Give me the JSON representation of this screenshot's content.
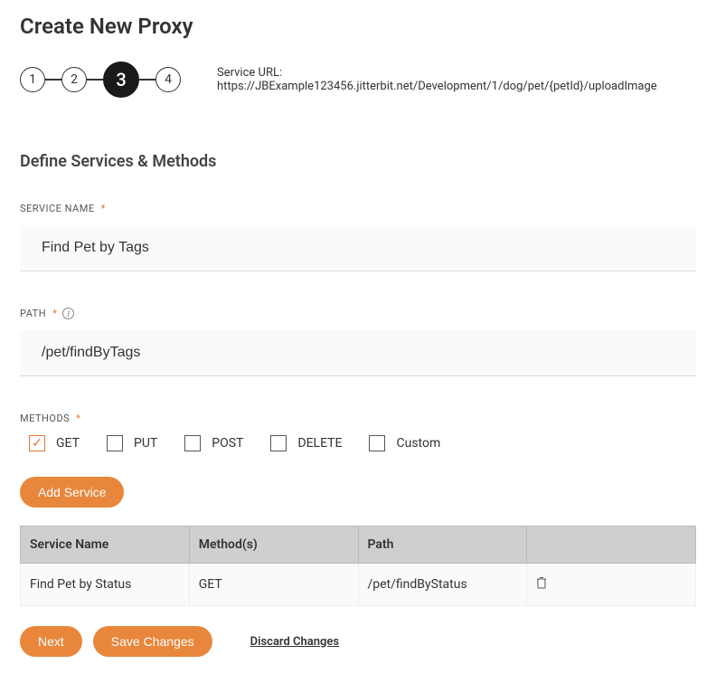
{
  "page": {
    "title": "Create New Proxy",
    "service_url_label": "Service URL:",
    "service_url": "https://JBExample123456.jitterbit.net/Development/1/dog/pet/{petId}/uploadImage"
  },
  "stepper": {
    "steps": [
      "1",
      "2",
      "3",
      "4"
    ],
    "active": "3"
  },
  "section": {
    "title": "Define Services & Methods"
  },
  "fields": {
    "service_name": {
      "label": "SERVICE NAME",
      "value": "Find Pet by Tags"
    },
    "path": {
      "label": "PATH",
      "value": "/pet/findByTags"
    },
    "methods": {
      "label": "METHODS",
      "options": [
        {
          "label": "GET",
          "checked": true
        },
        {
          "label": "PUT",
          "checked": false
        },
        {
          "label": "POST",
          "checked": false
        },
        {
          "label": "DELETE",
          "checked": false
        },
        {
          "label": "Custom",
          "checked": false
        }
      ]
    }
  },
  "buttons": {
    "add_service": "Add Service",
    "next": "Next",
    "save_changes": "Save Changes",
    "discard_changes": "Discard Changes"
  },
  "table": {
    "headers": [
      "Service Name",
      "Method(s)",
      "Path",
      ""
    ],
    "rows": [
      {
        "service_name": "Find Pet by Status",
        "methods": "GET",
        "path": "/pet/findByStatus"
      }
    ]
  }
}
